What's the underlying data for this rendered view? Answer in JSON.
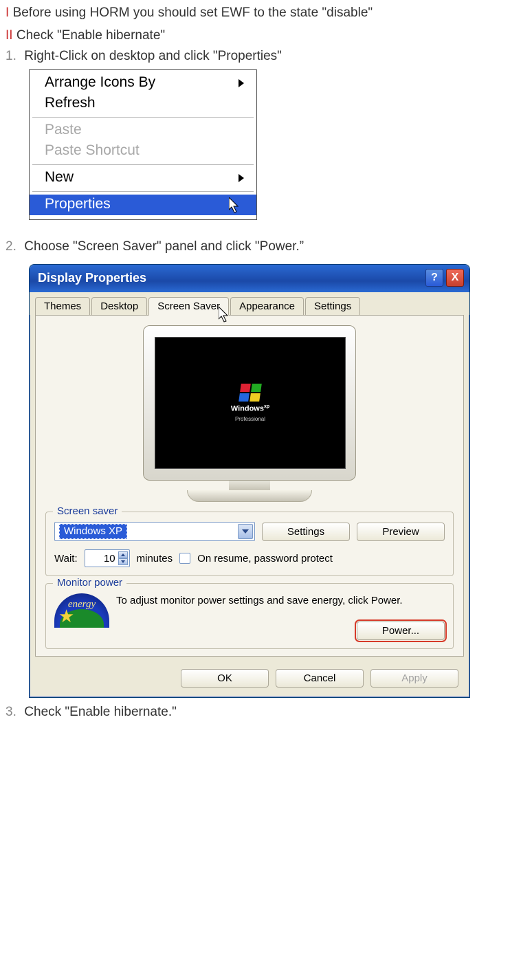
{
  "intro": {
    "prefix1": "I",
    "line1": "Before using HORM you should set EWF to the state \"disable\"",
    "prefix2": "II",
    "line2": "Check \"Enable hibernate\""
  },
  "steps": {
    "s1_num": "1.",
    "s1_text": "Right-Click on desktop and click \"Properties\"",
    "s2_num": "2.",
    "s2_text": "Choose \"Screen Saver\" panel and click \"Power.”",
    "s3_num": "3.",
    "s3_text": "Check \"Enable hibernate.\""
  },
  "ctxmenu": {
    "arrange": "Arrange Icons By",
    "refresh": "Refresh",
    "paste": "Paste",
    "paste_shortcut": "Paste Shortcut",
    "new": "New",
    "properties": "Properties"
  },
  "dialog": {
    "title": "Display Properties",
    "help": "?",
    "close": "X",
    "tabs": {
      "themes": "Themes",
      "desktop": "Desktop",
      "screensaver": "Screen Saver",
      "appearance": "Appearance",
      "settings": "Settings"
    },
    "logo": {
      "line1": "Windows",
      "line2": "Professional"
    },
    "ss_group": "Screen saver",
    "ss_select": "Windows XP",
    "btn_settings": "Settings",
    "btn_preview": "Preview",
    "wait_label": "Wait:",
    "wait_value": "10",
    "minutes": "minutes",
    "resume": "On resume, password protect",
    "mp_group": "Monitor power",
    "mp_text": "To adjust monitor power settings and save energy, click Power.",
    "energy_script": "energy",
    "btn_power": "Power...",
    "btn_ok": "OK",
    "btn_cancel": "Cancel",
    "btn_apply": "Apply"
  }
}
